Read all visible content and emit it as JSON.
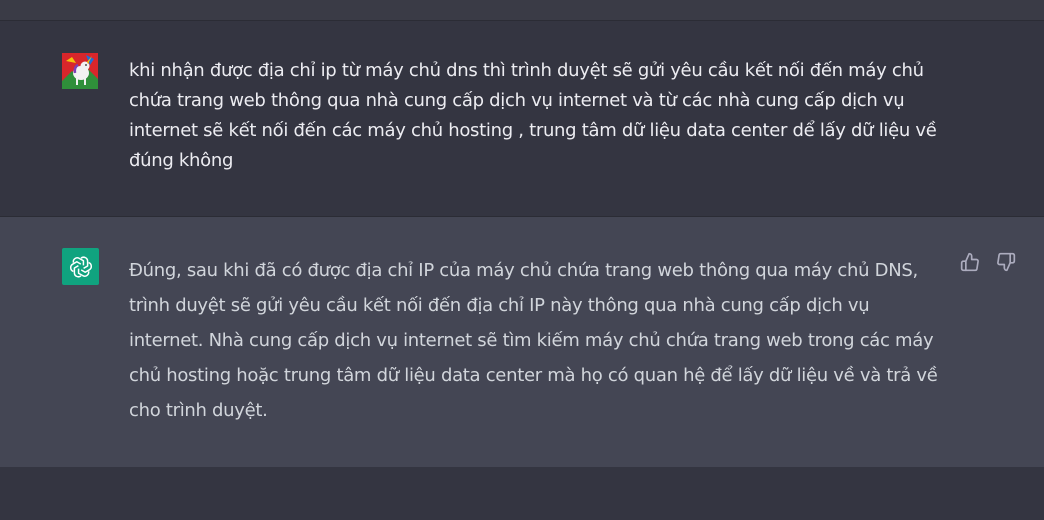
{
  "conversation": {
    "user_message": {
      "avatar_icon": "unicorn-avatar-icon",
      "text": "khi nhận được địa chỉ ip từ máy chủ dns thì trình duyệt sẽ gửi yêu cầu kết nối đến máy chủ chứa trang web thông qua nhà cung cấp  dịch vụ internet và từ các nhà cung cấp dịch vụ internet sẽ kết nối đến các máy chủ hosting , trung tâm dữ liệu data center dể lấy dữ liệu về đúng không"
    },
    "assistant_message": {
      "avatar_icon": "openai-logo-icon",
      "text": "Đúng, sau khi đã có được địa chỉ IP của máy chủ chứa trang web thông qua máy chủ DNS, trình duyệt sẽ gửi yêu cầu kết nối đến địa chỉ IP này thông qua nhà cung cấp dịch vụ internet. Nhà cung cấp dịch vụ internet sẽ tìm kiếm máy chủ chứa trang web trong các máy chủ hosting hoặc trung tâm dữ liệu data center mà họ có quan hệ để lấy dữ liệu về và trả về cho trình duyệt.",
      "feedback_icons": [
        "thumbs-up-icon",
        "thumbs-down-icon"
      ]
    }
  },
  "colors": {
    "user_row_bg": "#343541",
    "assistant_row_bg": "#444654",
    "bot_avatar_bg": "#10a37f",
    "text": "#ececf1"
  }
}
